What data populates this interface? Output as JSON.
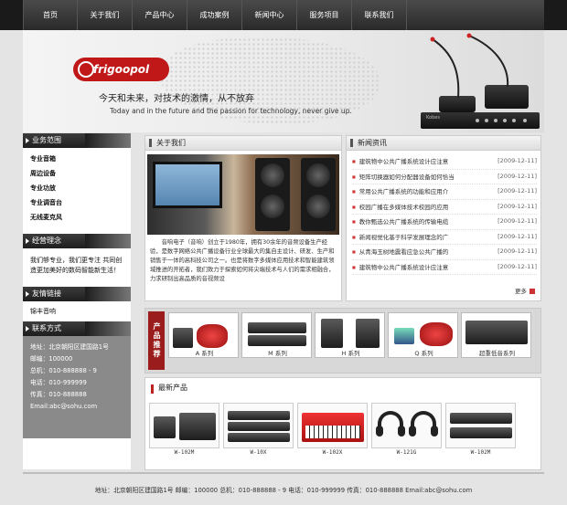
{
  "nav": {
    "items": [
      "首页",
      "关于我们",
      "产品中心",
      "成功案例",
      "新闻中心",
      "服务项目",
      "联系我们"
    ]
  },
  "banner": {
    "logo_text": "frigoopol",
    "slogan_cn": "今天和未来，对技术的激情，从不放弃",
    "slogan_en": "Today and in the future and the passion for technology, never give up.",
    "equipment_brand": "Kobes"
  },
  "sidebar": {
    "business": {
      "title": "业务范围",
      "items": [
        "专业音箱",
        "周边设备",
        "专业功放",
        "专业调音台",
        "无线麦克风"
      ]
    },
    "idea": {
      "title": "经营理念",
      "text": "我们够专业，我们更专注 共同创造更加美好的数码智能新生活！"
    },
    "links": {
      "title": "友情链接",
      "items": [
        "锦丰音响"
      ]
    },
    "contact": {
      "title": "联系方式",
      "lines": [
        "地址：北京朝阳区建国路1号",
        "邮编：100000",
        "总机：010-888888 - 9",
        "电话：010-999999",
        "传真：010-888888",
        "Email:abc@sohu.com"
      ]
    }
  },
  "about": {
    "title": "关于我们",
    "text": "音响电子（音响）创立于1980年，拥有30余年的音频设备生产经验，是数字网络公共广播设备行业全球最大的集自主设计、研发、生产和销售于一体的高科技公司之一。也是将数字多媒体应用技术和智能建筑领域推进的开拓者，我们致力于探索如何将尖端技术与人们的需求相融合，力求研制出高品质的音视频设"
  },
  "news": {
    "title": "新闻资讯",
    "items": [
      {
        "title": "建筑物中公共广播系统设计应注意",
        "date": "[2009-12-11]"
      },
      {
        "title": "矩阵切换器如何分配器设备如何恰当",
        "date": "[2009-12-11]"
      },
      {
        "title": "常用公共广播系统的功能和应用介",
        "date": "[2009-12-11]"
      },
      {
        "title": "校园广播在多媒体技术校园的应用",
        "date": "[2009-12-11]"
      },
      {
        "title": "教你甄选公共广播系统的传输电缆",
        "date": "[2009-12-11]"
      },
      {
        "title": "新闻视觉化基于科学发展理念的广",
        "date": "[2009-12-11]"
      },
      {
        "title": "从青海玉树地震看应急公共广播的",
        "date": "[2009-12-11]"
      },
      {
        "title": "建筑物中公共广播系统设计应注意",
        "date": "[2009-12-11]"
      }
    ],
    "more": "更多"
  },
  "showcase": {
    "tag": "产品推荐",
    "items": [
      "A 系列",
      "M 系列",
      "H 系列",
      "Q 系列",
      "超重低音系列"
    ]
  },
  "new_products": {
    "title": "最新产品",
    "items": [
      "W-102M",
      "W-10X",
      "W-102X",
      "W-121G",
      "W-102M"
    ]
  },
  "footer": {
    "text": "地址：北京朝阳区建国路1号 邮编：100000 总机：010-888888 - 9 电话：010-999999 传真：010-888888 Email:abc@sohu.com"
  },
  "colors": {
    "accent_red": "#9b1c1c",
    "dark_header": "#2a2a2a",
    "sidebar_contact_bg": "#8a8a8a"
  }
}
